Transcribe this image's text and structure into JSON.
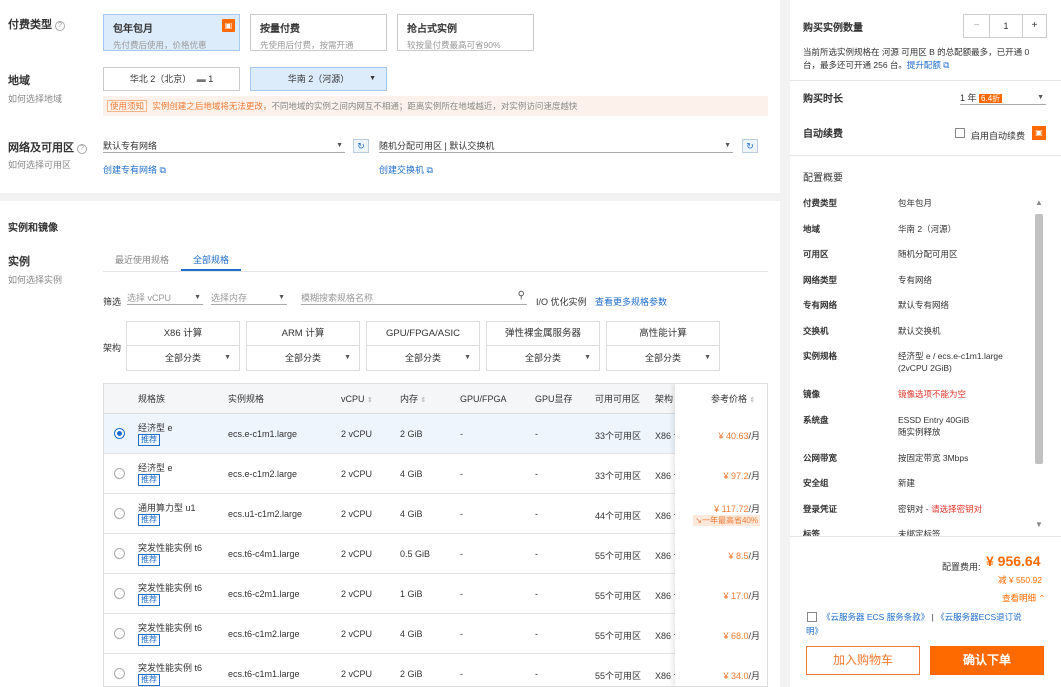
{
  "billing": {
    "label": "付费类型",
    "options": [
      {
        "title": "包年包月",
        "desc": "先付费后使用，价格优惠"
      },
      {
        "title": "按量付费",
        "desc": "先使用后付费，按需开通"
      },
      {
        "title": "抢占式实例",
        "desc": "较按量付费最高可省90%"
      }
    ]
  },
  "region": {
    "label": "地域",
    "help": "如何选择地域",
    "options": [
      "华北 2（北京）",
      "华南 2（河源）"
    ],
    "option1_suffix": "1",
    "notice_tag": "使用须知",
    "notice_warn": "实例创建之后地域将无法更改，",
    "notice_text": "不同地域的实例之间内网互不相通；距离实例所在地域越近，对实例访问速度越快"
  },
  "network": {
    "label": "网络及可用区",
    "help": "如何选择可用区",
    "vpc_value": "默认专有网络",
    "vpc_link": "创建专有网络",
    "vswitch_value": "随机分配可用区 | 默认交换机",
    "vswitch_link": "创建交换机"
  },
  "section2_title": "实例和镜像",
  "instance": {
    "label": "实例",
    "help": "如何选择实例",
    "tabs": [
      "最近使用规格",
      "全部规格"
    ],
    "filter_label": "筛选",
    "vcpu_placeholder": "选择 vCPU",
    "mem_placeholder": "选择内存",
    "search_placeholder": "模糊搜索规格名称",
    "io_label": "I/O 优化实例",
    "more_link": "查看更多规格参数",
    "arch_label": "架构",
    "arches": [
      {
        "name": "X86 计算",
        "sub": "全部分类"
      },
      {
        "name": "ARM 计算",
        "sub": "全部分类"
      },
      {
        "name": "GPU/FPGA/ASIC",
        "sub": "全部分类"
      },
      {
        "name": "弹性裸金属服务器",
        "sub": "全部分类"
      },
      {
        "name": "高性能计算",
        "sub": "全部分类"
      }
    ],
    "columns": [
      "规格族",
      "实例规格",
      "vCPU",
      "内存",
      "GPU/FPGA",
      "GPU显存",
      "可用可用区",
      "架构",
      "参考价格"
    ],
    "rec_label": "推荐",
    "rows": [
      {
        "family": "经济型 e",
        "spec": "ecs.e-c1m1.large",
        "vcpu": "2 vCPU",
        "mem": "2 GiB",
        "gpu": "-",
        "gmem": "-",
        "zones": "33个可用区",
        "arch": "X86 计",
        "price": "¥ 40.63",
        "unit": "/月",
        "selected": true
      },
      {
        "family": "经济型 e",
        "spec": "ecs.e-c1m2.large",
        "vcpu": "2 vCPU",
        "mem": "4 GiB",
        "gpu": "-",
        "gmem": "-",
        "zones": "33个可用区",
        "arch": "X86 计",
        "price": "¥ 97.2",
        "unit": "/月"
      },
      {
        "family": "通用算力型 u1",
        "spec": "ecs.u1-c1m2.large",
        "vcpu": "2 vCPU",
        "mem": "4 GiB",
        "gpu": "-",
        "gmem": "-",
        "zones": "44个可用区",
        "arch": "X86 计",
        "price": "¥ 117.72",
        "unit": "/月",
        "discount": "一年最高省40%"
      },
      {
        "family": "突发性能实例 t6",
        "spec": "ecs.t6-c4m1.large",
        "vcpu": "2 vCPU",
        "mem": "0.5 GiB",
        "gpu": "-",
        "gmem": "-",
        "zones": "55个可用区",
        "arch": "X86 计",
        "price": "¥ 8.5",
        "unit": "/月"
      },
      {
        "family": "突发性能实例 t6",
        "spec": "ecs.t6-c2m1.large",
        "vcpu": "2 vCPU",
        "mem": "1 GiB",
        "gpu": "-",
        "gmem": "-",
        "zones": "55个可用区",
        "arch": "X86 计",
        "price": "¥ 17.0",
        "unit": "/月"
      },
      {
        "family": "突发性能实例 t6",
        "spec": "ecs.t6-c1m2.large",
        "vcpu": "2 vCPU",
        "mem": "4 GiB",
        "gpu": "-",
        "gmem": "-",
        "zones": "55个可用区",
        "arch": "X86 计",
        "price": "¥ 68.0",
        "unit": "/月"
      },
      {
        "family": "突发性能实例 t6",
        "spec": "ecs.t6-c1m1.large",
        "vcpu": "2 vCPU",
        "mem": "2 GiB",
        "gpu": "-",
        "gmem": "-",
        "zones": "55个可用区",
        "arch": "X86 计",
        "price": "¥ 34.0",
        "unit": "/月"
      }
    ]
  },
  "side": {
    "qty_label": "购买实例数量",
    "qty_value": "1",
    "qty_minus": "−",
    "qty_plus": "+",
    "qty_note_1": "当前所选实例规格在 河源 可用区 B 的总配额最多，已开通 0",
    "qty_note_2": "台，最多还可开通 256 台。",
    "qty_link": "提升配额",
    "duration_label": "购买时长",
    "duration_value": "1 年",
    "duration_badge": "6.4折",
    "auto_label": "自动续费",
    "auto_check_label": "启用自动续费",
    "summary_title": "配置概要",
    "summary": [
      {
        "k": "付费类型",
        "v": "包年包月"
      },
      {
        "k": "地域",
        "v": "华南 2（河源）"
      },
      {
        "k": "可用区",
        "v": "随机分配可用区"
      },
      {
        "k": "网络类型",
        "v": "专有网络"
      },
      {
        "k": "专有网络",
        "v": "默认专有网络"
      },
      {
        "k": "交换机",
        "v": "默认交换机"
      },
      {
        "k": "实例规格",
        "v": "经济型 e / ecs.e-c1m1.large",
        "v2": "(2vCPU 2GiB)"
      },
      {
        "k": "镜像",
        "v": "镜像选项不能为空",
        "warn": true
      },
      {
        "k": "系统盘",
        "v": "ESSD Entry 40GiB",
        "v2": "随实例释放"
      },
      {
        "k": "公网带宽",
        "v": "按固定带宽 3Mbps"
      },
      {
        "k": "安全组",
        "v": "新建"
      },
      {
        "k": "登录凭证",
        "v": "密钥对 - ",
        "v_warn": "请选择密钥对"
      },
      {
        "k": "标签",
        "v": "未绑定标签"
      }
    ],
    "fee_label": "配置费用:",
    "fee_value": "¥ 956.64",
    "fee_saved": "减 ¥ 550.92",
    "detail_link": "查看明细",
    "terms_1": "《云服务器 ECS 服务条款》",
    "terms_sep": "|",
    "terms_2": "《云服务器ECS退订说",
    "terms_3": "明》",
    "add_cart": "加入购物车",
    "confirm": "确认下单"
  },
  "colors": {
    "accent": "#1e6dcc",
    "orange": "#ff6a00",
    "selected_bg": "#ddecfb"
  }
}
